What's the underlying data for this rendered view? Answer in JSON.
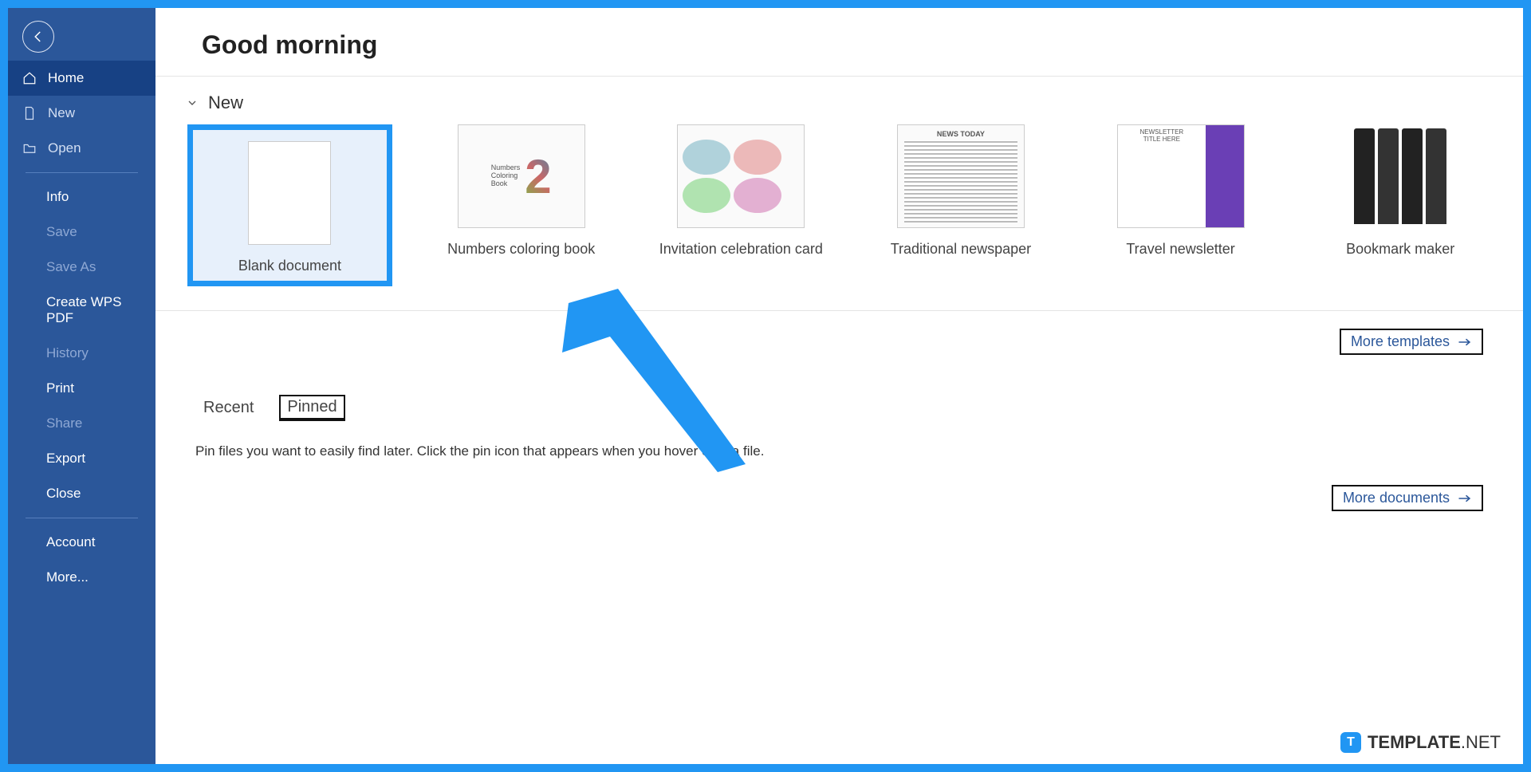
{
  "greeting": "Good morning",
  "sidebar": {
    "home": "Home",
    "new": "New",
    "open": "Open",
    "info": "Info",
    "save": "Save",
    "save_as": "Save As",
    "create_wps_pdf": "Create WPS PDF",
    "history": "History",
    "print": "Print",
    "share": "Share",
    "export": "Export",
    "close": "Close",
    "account": "Account",
    "more": "More..."
  },
  "section_new": "New",
  "templates": {
    "blank": "Blank document",
    "numbers": "Numbers coloring book",
    "invitation": "Invitation celebration card",
    "newspaper": "Traditional newspaper",
    "travel": "Travel newsletter",
    "bookmark": "Bookmark maker"
  },
  "more_templates": "More templates",
  "tabs": {
    "recent": "Recent",
    "pinned": "Pinned"
  },
  "pinned_note": "Pin files you want to easily find later. Click the pin icon that appears when you hover over a file.",
  "more_documents": "More documents",
  "watermark": {
    "brand_bold": "TEMPLATE",
    "brand_light": ".NET"
  }
}
